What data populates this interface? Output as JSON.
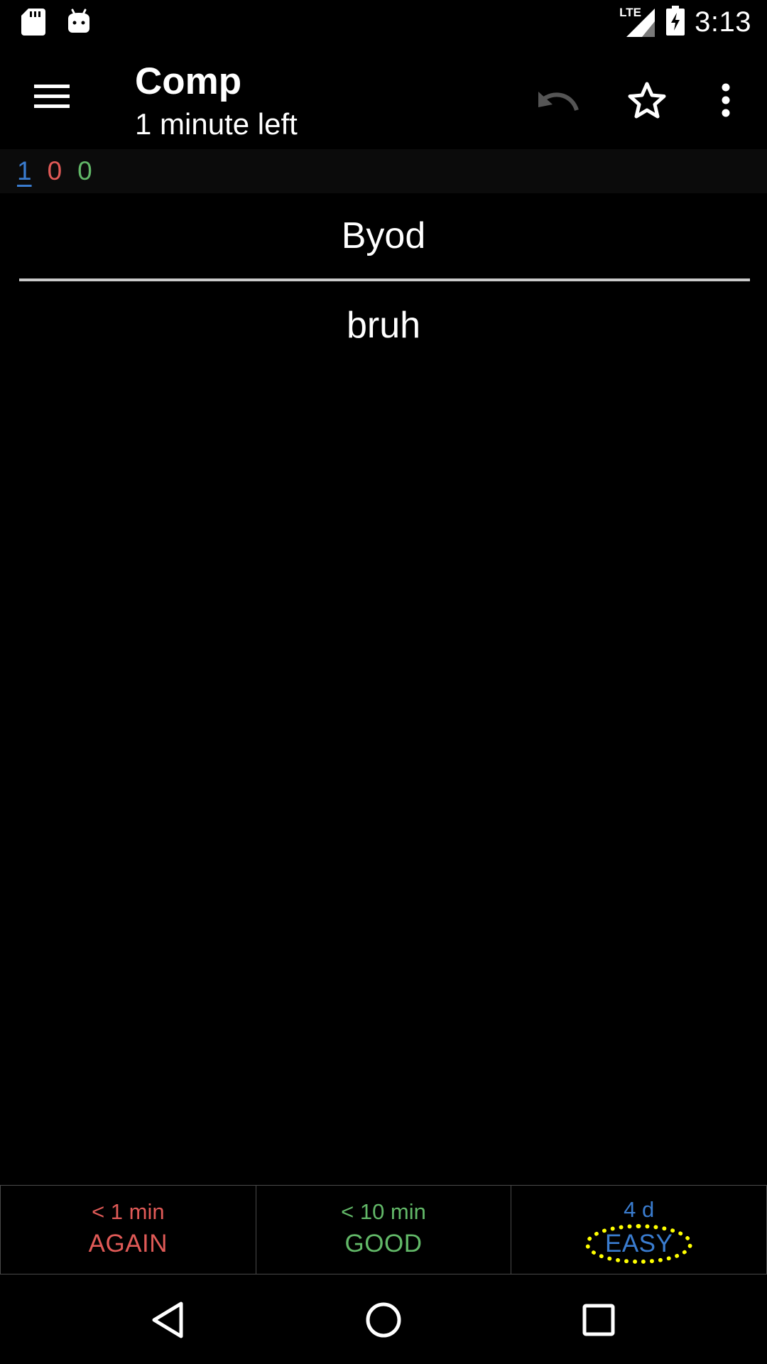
{
  "status_bar": {
    "time": "3:13",
    "network": "LTE",
    "icons": [
      "sd-card-icon",
      "android-icon",
      "signal-icon",
      "battery-charging-icon"
    ]
  },
  "toolbar": {
    "title": "Comp",
    "subtitle": "1 minute left",
    "icons": [
      "menu-icon",
      "undo-icon",
      "star-icon",
      "more-vert-icon"
    ]
  },
  "counts": {
    "new": "1",
    "learning": "0",
    "review": "0"
  },
  "card": {
    "front": "Byod",
    "back": "bruh"
  },
  "answer_buttons": [
    {
      "interval": "< 1 min",
      "label": "AGAIN"
    },
    {
      "interval": "< 10 min",
      "label": "GOOD"
    },
    {
      "interval": "4 d",
      "label": "EASY"
    }
  ],
  "colors": {
    "again": "#e05a57",
    "good": "#62b868",
    "easy": "#3a7ccf",
    "highlight": "#ffff00"
  },
  "nav_bar": {
    "icons": [
      "back-icon",
      "home-icon",
      "recents-icon"
    ]
  }
}
